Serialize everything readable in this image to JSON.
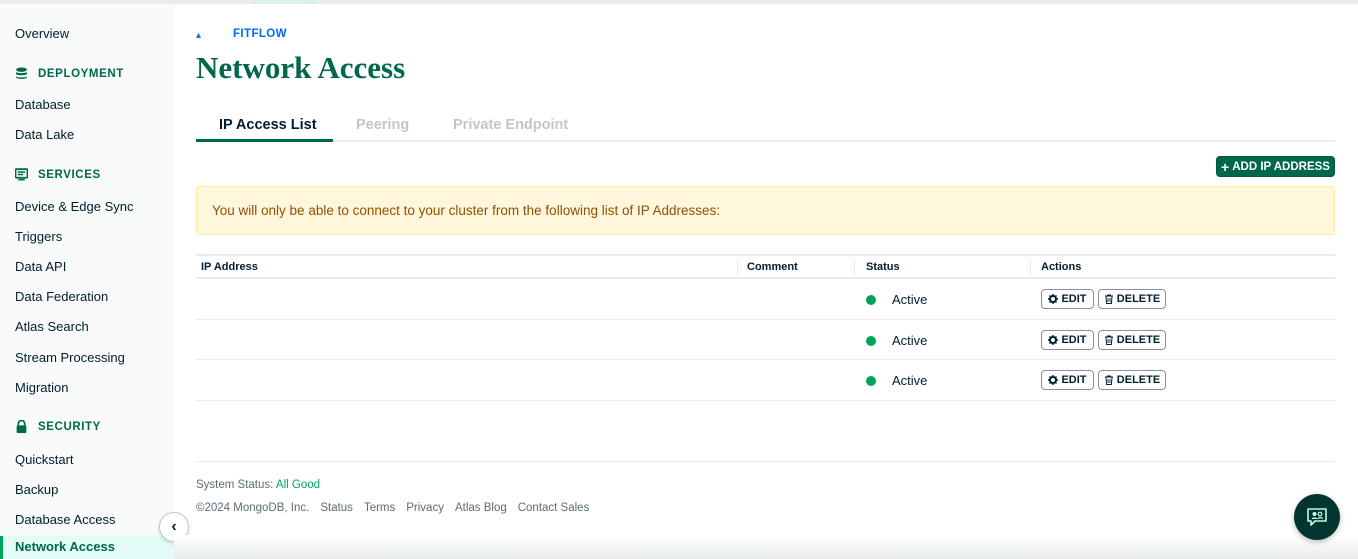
{
  "breadcrumb": {
    "project": "FITFLOW"
  },
  "page": {
    "title": "Network Access"
  },
  "sidebar": {
    "overview": "Overview",
    "sections": [
      {
        "title": "DEPLOYMENT",
        "icon": "database-icon",
        "items": [
          "Database",
          "Data Lake"
        ]
      },
      {
        "title": "SERVICES",
        "icon": "monitor-icon",
        "items": [
          "Device & Edge Sync",
          "Triggers",
          "Data API",
          "Data Federation",
          "Atlas Search",
          "Stream Processing",
          "Migration"
        ]
      },
      {
        "title": "SECURITY",
        "icon": "lock-icon",
        "items": [
          "Quickstart",
          "Backup",
          "Database Access",
          "Network Access"
        ]
      }
    ],
    "active_item": "Network Access",
    "collapse_icon": "chevron-left-icon"
  },
  "tabs": [
    "IP Access List",
    "Peering",
    "Private Endpoint"
  ],
  "active_tab": "IP Access List",
  "add_button": {
    "icon": "plus-icon",
    "label": "ADD IP ADDRESS"
  },
  "banner": {
    "text": "You will only be able to connect to your cluster from the following list of IP Addresses:"
  },
  "table": {
    "headers": [
      "IP Address",
      "Comment",
      "Status",
      "Actions"
    ],
    "rows": [
      {
        "ip": "",
        "comment": "",
        "status": "Active",
        "edit": "EDIT",
        "delete": "DELETE"
      },
      {
        "ip": "",
        "comment": "",
        "status": "Active",
        "edit": "EDIT",
        "delete": "DELETE"
      },
      {
        "ip": "",
        "comment": "",
        "status": "Active",
        "edit": "EDIT",
        "delete": "DELETE"
      }
    ]
  },
  "footer": {
    "status_label": "System Status:",
    "status_value": "All Good",
    "copyright": "©2024 MongoDB, Inc.",
    "links": [
      "Status",
      "Terms",
      "Privacy",
      "Atlas Blog",
      "Contact Sales"
    ]
  },
  "chat": {
    "icon": "chat-assistant-icon"
  },
  "colors": {
    "brand_green": "#00684a",
    "status_active": "#00a35c",
    "link_blue": "#016bf8",
    "banner_bg": "#fef7db"
  }
}
